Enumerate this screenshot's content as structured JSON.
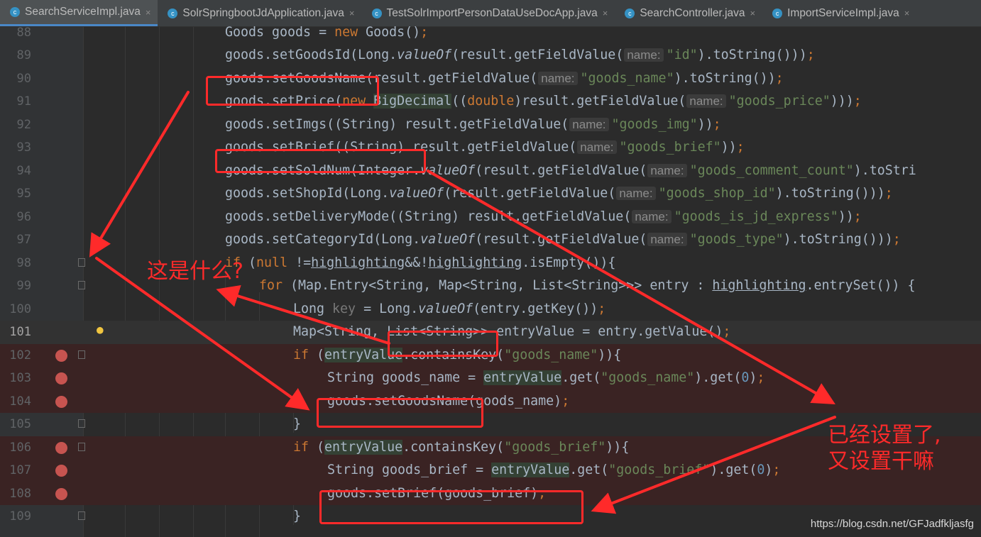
{
  "tabs": [
    {
      "icon": "c",
      "label": "SearchServiceImpl.java",
      "active": true
    },
    {
      "icon": "c",
      "label": "SolrSpringbootJdApplication.java",
      "active": false
    },
    {
      "icon": "c",
      "label": "TestSolrImportPersonDataUseDocApp.java",
      "active": false
    },
    {
      "icon": "c",
      "label": "SearchController.java",
      "active": false
    },
    {
      "icon": "c",
      "label": "ImportServiceImpl.java",
      "active": false
    }
  ],
  "close_glyph": "×",
  "param_hint": "name:",
  "lines": [
    {
      "num": "88",
      "tokens": [
        [
          "",
          "Goods goods = "
        ],
        [
          "k",
          "new "
        ],
        [
          "",
          "Goods()"
        ],
        [
          "k",
          ";"
        ]
      ]
    },
    {
      "num": "89",
      "tokens": [
        [
          "",
          "goods.setGoodsId(Long."
        ],
        [
          "i",
          "valueOf"
        ],
        [
          "",
          "(result.getFieldValue("
        ],
        [
          "hint",
          "name:"
        ],
        [
          "s",
          "\"id\""
        ],
        [
          "",
          ").toString()))"
        ],
        [
          "k",
          ";"
        ]
      ]
    },
    {
      "num": "90",
      "tokens": [
        [
          "",
          "goods.setGoodsName(result.getFieldValue("
        ],
        [
          "hint",
          "name:"
        ],
        [
          "s",
          "\"goods_name\""
        ],
        [
          "",
          ").toString())"
        ],
        [
          "k",
          ";"
        ]
      ]
    },
    {
      "num": "91",
      "tokens": [
        [
          "",
          "goods.setPrice("
        ],
        [
          "k",
          "new "
        ],
        [
          "hl",
          "BigDecimal"
        ],
        [
          "",
          "(("
        ],
        [
          "k",
          "double"
        ],
        [
          "",
          ")result.getFieldValue("
        ],
        [
          "hint",
          "name:"
        ],
        [
          "s",
          "\"goods_price\""
        ],
        [
          "",
          ")))"
        ],
        [
          "k",
          ";"
        ]
      ]
    },
    {
      "num": "92",
      "tokens": [
        [
          "",
          "goods.setImgs((String) result.getFieldValue("
        ],
        [
          "hint",
          "name:"
        ],
        [
          "s",
          "\"goods_img\""
        ],
        [
          "",
          "))"
        ],
        [
          "k",
          ";"
        ]
      ]
    },
    {
      "num": "93",
      "tokens": [
        [
          "",
          "goods.setBrief((String) result.getFieldValue("
        ],
        [
          "hint",
          "name:"
        ],
        [
          "s",
          "\"goods_brief\""
        ],
        [
          "",
          "))"
        ],
        [
          "k",
          ";"
        ]
      ]
    },
    {
      "num": "94",
      "tokens": [
        [
          "",
          "goods.setSoldNum(Integer."
        ],
        [
          "i",
          "valueOf"
        ],
        [
          "",
          "(result.getFieldValue("
        ],
        [
          "hint",
          "name:"
        ],
        [
          "s",
          "\"goods_comment_count\""
        ],
        [
          "",
          ").toStri"
        ]
      ]
    },
    {
      "num": "95",
      "tokens": [
        [
          "",
          "goods.setShopId(Long."
        ],
        [
          "i",
          "valueOf"
        ],
        [
          "",
          "(result.getFieldValue("
        ],
        [
          "hint",
          "name:"
        ],
        [
          "s",
          "\"goods_shop_id\""
        ],
        [
          "",
          ").toString()))"
        ],
        [
          "k",
          ";"
        ]
      ]
    },
    {
      "num": "96",
      "tokens": [
        [
          "",
          "goods.setDeliveryMode((String) result.getFieldValue("
        ],
        [
          "hint",
          "name:"
        ],
        [
          "s",
          "\"goods_is_jd_express\""
        ],
        [
          "",
          "))"
        ],
        [
          "k",
          ";"
        ]
      ]
    },
    {
      "num": "97",
      "tokens": [
        [
          "",
          "goods.setCategoryId(Long."
        ],
        [
          "i",
          "valueOf"
        ],
        [
          "",
          "(result.getFieldValue("
        ],
        [
          "hint",
          "name:"
        ],
        [
          "s",
          "\"goods_type\""
        ],
        [
          "",
          ").toString()))"
        ],
        [
          "k",
          ";"
        ]
      ]
    },
    {
      "num": "98",
      "tokens": [
        [
          "k",
          "if "
        ],
        [
          "",
          "("
        ],
        [
          "k",
          "null "
        ],
        [
          "",
          "!="
        ],
        [
          "u",
          "highlighting"
        ],
        [
          "",
          "&&!"
        ],
        [
          "u",
          "highlighting"
        ],
        [
          "",
          ".isEmpty()){"
        ]
      ]
    },
    {
      "num": "99",
      "tokens": [
        [
          "k",
          "for "
        ],
        [
          "",
          "(Map.Entry<String, Map<String, List<String>>> entry : "
        ],
        [
          "u",
          "highlighting"
        ],
        [
          "",
          ".entrySet()) {"
        ]
      ]
    },
    {
      "num": "100",
      "tokens": [
        [
          "",
          "Long "
        ],
        [
          "dim",
          "key"
        ],
        [
          "",
          " = Long."
        ],
        [
          "i",
          "valueOf"
        ],
        [
          "",
          "(entry.getKey())"
        ],
        [
          "k",
          ";"
        ]
      ]
    },
    {
      "num": "101",
      "tokens": [
        [
          "",
          "Map<String, List<String>> entryValue = entry.getValue()"
        ],
        [
          "k",
          ";"
        ]
      ]
    },
    {
      "num": "102",
      "tokens": [
        [
          "k",
          "if "
        ],
        [
          "",
          "("
        ],
        [
          "hl",
          "entryValue"
        ],
        [
          "",
          ".containsKey("
        ],
        [
          "s",
          "\"goods_name\""
        ],
        [
          "",
          "))"
        ],
        [
          "",
          "{"
        ]
      ]
    },
    {
      "num": "103",
      "tokens": [
        [
          "",
          "String goods_name = "
        ],
        [
          "hl",
          "entryValue"
        ],
        [
          "",
          ".get("
        ],
        [
          "s",
          "\"goods_name\""
        ],
        [
          "",
          ").get("
        ],
        [
          "n",
          "0"
        ],
        [
          "",
          ")"
        ],
        [
          "k",
          ";"
        ]
      ]
    },
    {
      "num": "104",
      "tokens": [
        [
          "",
          "goods.setGoodsName(goods_name)"
        ],
        [
          "k",
          ";"
        ]
      ]
    },
    {
      "num": "105",
      "tokens": [
        [
          "",
          "}"
        ]
      ]
    },
    {
      "num": "106",
      "tokens": [
        [
          "k",
          "if "
        ],
        [
          "",
          "("
        ],
        [
          "hl",
          "entryValue"
        ],
        [
          "",
          ".containsKey("
        ],
        [
          "s",
          "\"goods_brief\""
        ],
        [
          "",
          "))"
        ],
        [
          "",
          "{"
        ]
      ]
    },
    {
      "num": "107",
      "tokens": [
        [
          "",
          "String goods_brief = "
        ],
        [
          "hl",
          "entryValue"
        ],
        [
          "",
          ".get("
        ],
        [
          "s",
          "\"goods_brief\""
        ],
        [
          "",
          ").get("
        ],
        [
          "n",
          "0"
        ],
        [
          "",
          ")"
        ],
        [
          "k",
          ";"
        ]
      ]
    },
    {
      "num": "108",
      "tokens": [
        [
          "",
          "goods.setBrief(goods_brief)"
        ],
        [
          "k",
          ";"
        ]
      ]
    },
    {
      "num": "109",
      "tokens": [
        [
          "",
          "}"
        ]
      ]
    }
  ],
  "annotations": {
    "question": "这是什么?",
    "remark_line1": "已经设置了,",
    "remark_line2": "又设置干嘛"
  },
  "watermark": "https://blog.csdn.net/GFJadfkljasfg",
  "colors": {
    "annotation": "#ff2a2a",
    "breakpoint": "#c75450",
    "keyword": "#cc7832",
    "string": "#6a8759"
  }
}
